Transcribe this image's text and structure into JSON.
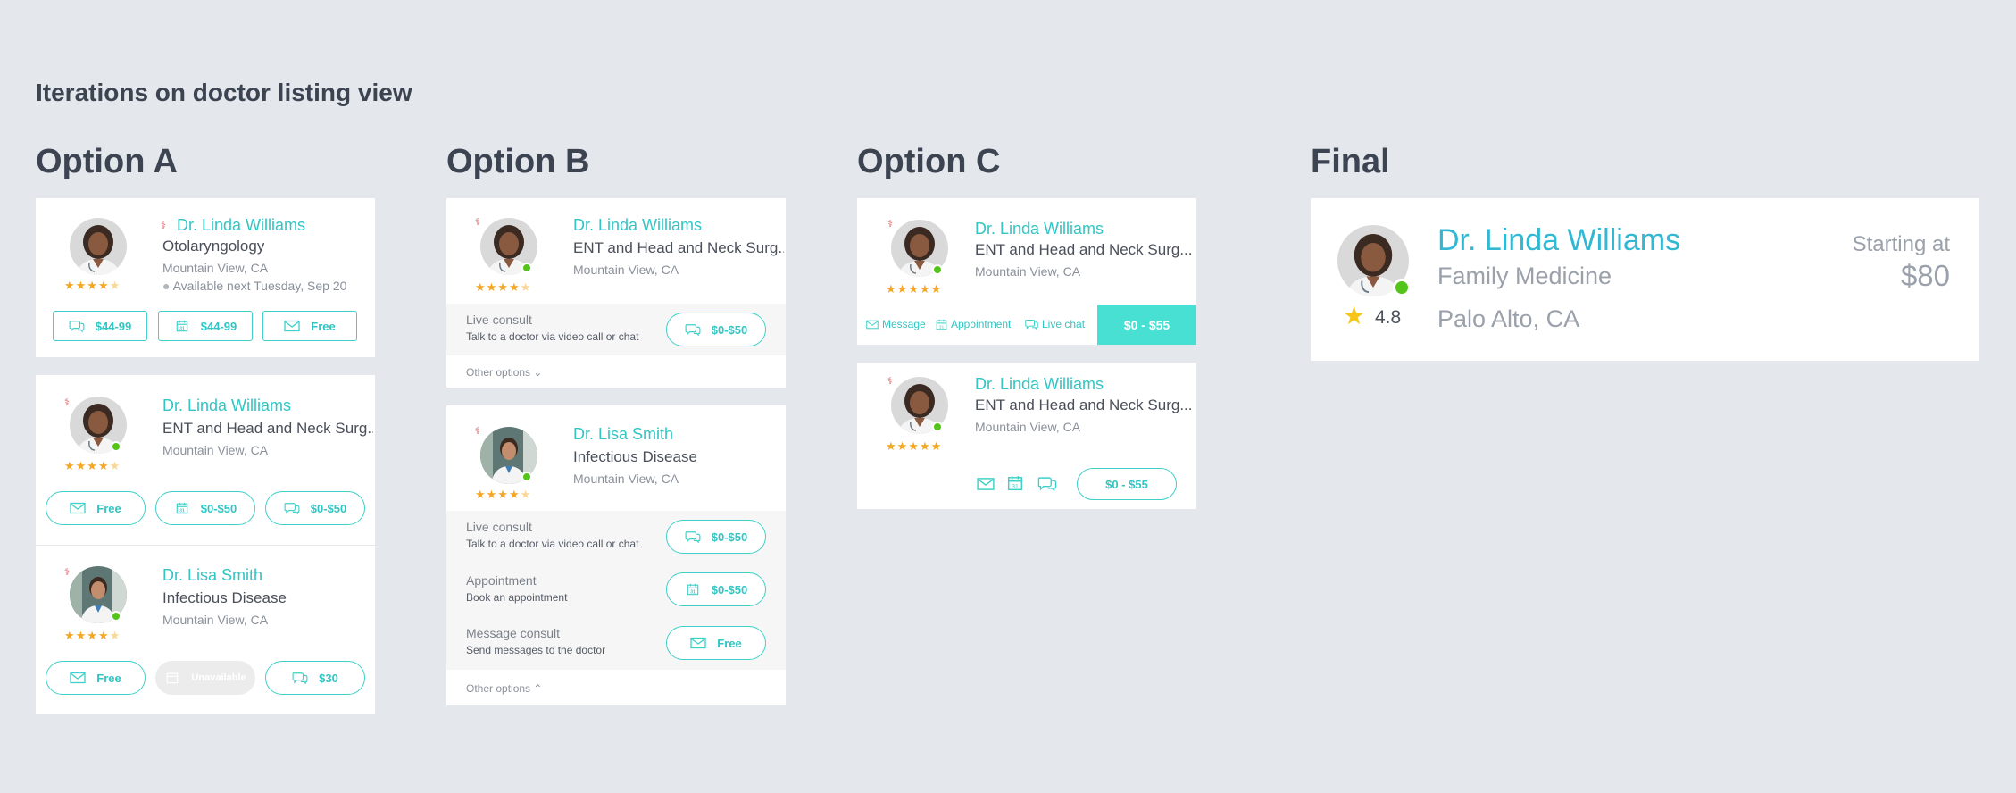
{
  "page": {
    "title": "Iterations on doctor listing view"
  },
  "columns": {
    "a": "Option A",
    "b": "Option B",
    "c": "Option C",
    "final": "Final"
  },
  "doctors": {
    "linda_oto": {
      "name": "Dr. Linda Williams",
      "specialty": "Otolaryngology",
      "location": "Mountain View, CA",
      "availability": "Available next Tuesday, Sep 20",
      "rating": 4
    },
    "linda_ent": {
      "name": "Dr. Linda Williams",
      "specialty": "ENT and Head and Neck Surg...",
      "location": "Mountain View, CA",
      "rating": 4
    },
    "lisa": {
      "name": "Dr. Lisa Smith",
      "specialty": "Infectious Disease",
      "location": "Mountain View, CA",
      "rating": 4
    },
    "linda_c": {
      "name": "Dr. Linda Williams",
      "specialty": "ENT and Head and Neck Surg...",
      "location": "Mountain View, CA",
      "rating": 5
    },
    "linda_final": {
      "name": "Dr. Linda Williams",
      "specialty": "Family Medicine",
      "location": "Palo Alto, CA",
      "rating": "4.8",
      "starting_label": "Starting at",
      "price": "$80"
    }
  },
  "option_a": {
    "card1_buttons": [
      "$44-99",
      "$44-99",
      "Free"
    ],
    "card2_buttons": [
      "Free",
      "$0-$50",
      "$0-$50"
    ],
    "card3_buttons": [
      "Free",
      "Unavailable",
      "$30"
    ]
  },
  "option_b": {
    "live_consult": {
      "title": "Live consult",
      "subtitle": "Talk to a doctor via video call or chat",
      "price": "$0-$50"
    },
    "appointment": {
      "title": "Appointment",
      "subtitle": "Book an appointment",
      "price": "$0-$50"
    },
    "message": {
      "title": "Message consult",
      "subtitle": "Send messages to the doctor",
      "price": "Free"
    },
    "other_options": "Other options"
  },
  "option_c": {
    "links": {
      "message": "Message",
      "appointment": "Appointment",
      "live_chat": "Live chat"
    },
    "price": "$0 - $55"
  },
  "colors": {
    "accent": "#32c5c3",
    "star": "#f5a623",
    "online": "#52c41a",
    "price_block": "#49e0d4"
  }
}
